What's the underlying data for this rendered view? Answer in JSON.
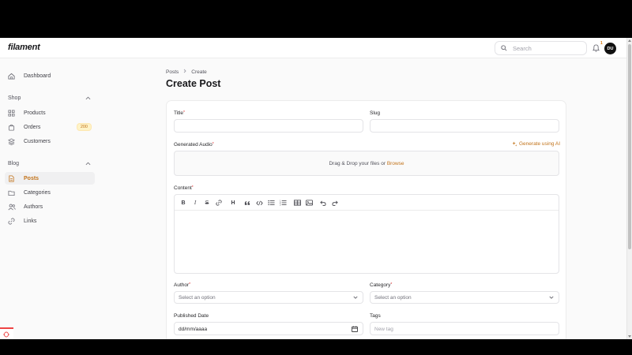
{
  "app": {
    "logo": "filament",
    "search_placeholder": "Search",
    "notification_count": "1",
    "user_initials": "DU"
  },
  "sidebar": {
    "dashboard": "Dashboard",
    "shop_group": "Shop",
    "products": "Products",
    "orders": "Orders",
    "orders_badge": "200",
    "customers": "Customers",
    "blog_group": "Blog",
    "posts": "Posts",
    "categories": "Categories",
    "authors": "Authors",
    "links": "Links"
  },
  "breadcrumb": {
    "root": "Posts",
    "current": "Create"
  },
  "page_title": "Create Post",
  "form": {
    "title_label": "Title",
    "slug_label": "Slug",
    "audio_label": "Generated Audio",
    "ai_link": "Generate using AI",
    "dropzone_text": "Drag & Drop your files or",
    "dropzone_browse": "Browse",
    "content_label": "Content",
    "author_label": "Author",
    "author_placeholder": "Select an option",
    "category_label": "Category",
    "category_placeholder": "Select an option",
    "published_label": "Published Date",
    "published_value": "dd/mm/aaaa",
    "tags_label": "Tags",
    "tags_placeholder": "New tag",
    "required_mark": "*"
  },
  "editor_toolbar": {
    "bold": "B",
    "italic": "I",
    "strike": "S",
    "heading": "H"
  },
  "colors": {
    "accent": "#c2731a",
    "badge_bg": "#fef3c7",
    "text": "#18181b"
  }
}
